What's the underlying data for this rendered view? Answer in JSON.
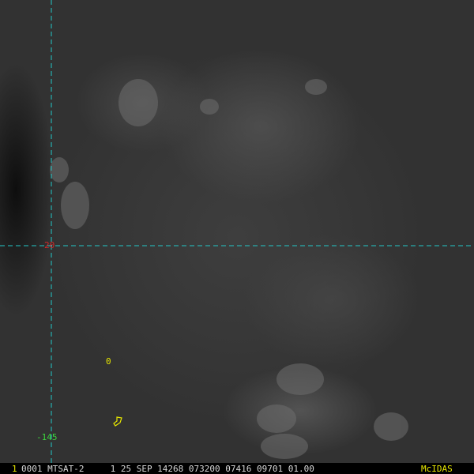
{
  "grid": {
    "latitude_label": "20",
    "longitude_label": "-145",
    "line_color": "#22c8c8"
  },
  "features": {
    "island_marker": "0"
  },
  "status_bar": {
    "frame_number": "1",
    "text": "0001 MTSAT-2     1 25 SEP 14268 073200 07416 09701 01.00",
    "brand": "McIDAS"
  },
  "colors": {
    "background": "#363636",
    "label_yellow": "#e8e800",
    "lat_red": "#d22a2a",
    "lon_green": "#3cd23c"
  }
}
